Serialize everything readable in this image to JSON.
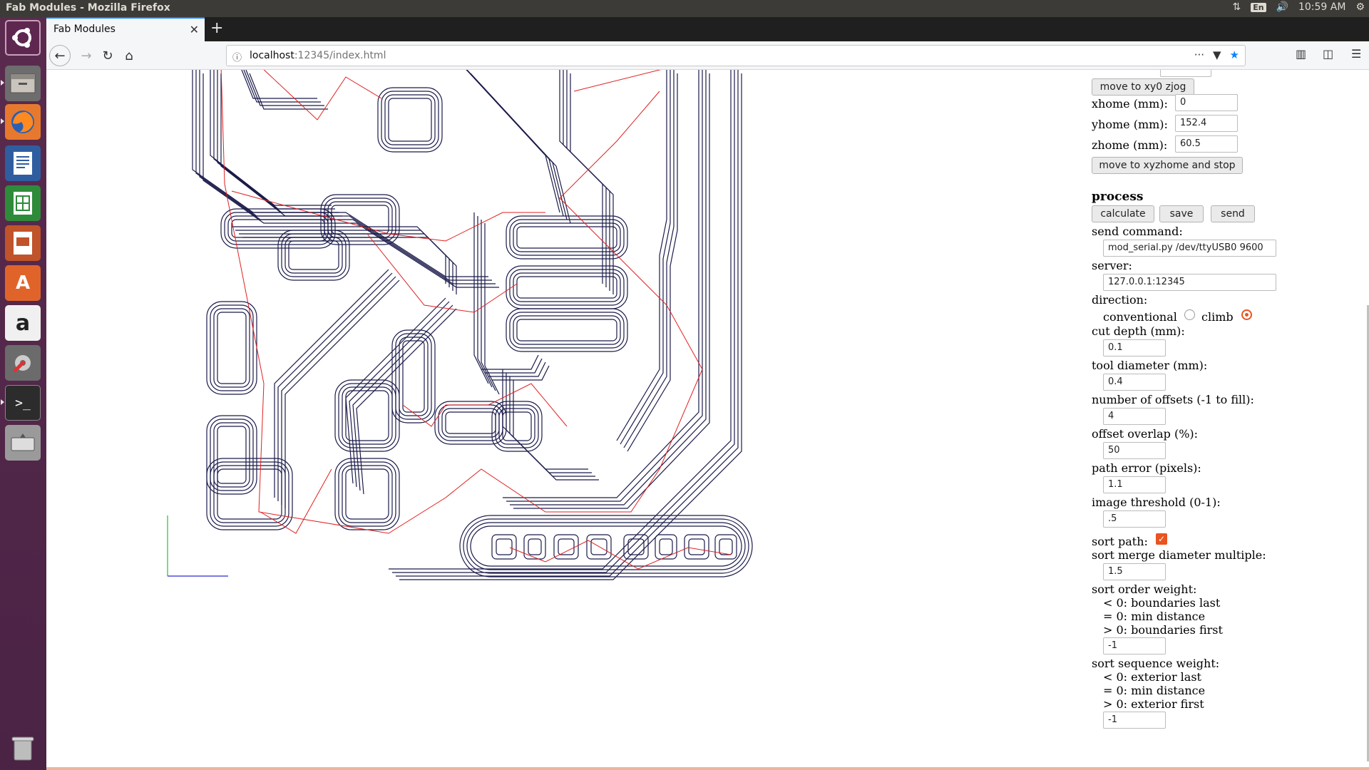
{
  "window": {
    "title": "Fab Modules - Mozilla Firefox"
  },
  "top_panel": {
    "keyboard": "En",
    "time": "10:59 AM"
  },
  "launcher": {
    "items": [
      "ubuntu-dash-icon",
      "files-icon",
      "firefox-icon",
      "writer-icon",
      "calc-icon",
      "impress-icon",
      "software-center-icon",
      "amazon-icon",
      "system-settings-icon",
      "terminal-icon",
      "disk-icon",
      "trash-icon"
    ]
  },
  "browser": {
    "tab_title": "Fab Modules",
    "url_host": "localhost",
    "url_path": ":12345/index.html"
  },
  "controls": {
    "move_xy0_zjog_label": "move to xy0 zjog",
    "xhome_label": "xhome (mm):",
    "xhome_value": "0",
    "yhome_label": "yhome (mm):",
    "yhome_value": "152.4",
    "zhome_label": "zhome (mm):",
    "zhome_value": "60.5",
    "move_home_label": "move to xyzhome and stop",
    "process_heading": "process",
    "calculate_label": "calculate",
    "save_label": "save",
    "send_label": "send",
    "send_command_label": "send command:",
    "send_command_value": "mod_serial.py /dev/ttyUSB0 9600",
    "server_label": "server:",
    "server_value": "127.0.0.1:12345",
    "direction_label": "direction:",
    "conventional_label": "conventional",
    "climb_label": "climb",
    "direction_selected": "climb",
    "cut_depth_label": "cut depth (mm):",
    "cut_depth_value": "0.1",
    "tool_diameter_label": "tool diameter (mm):",
    "tool_diameter_value": "0.4",
    "offsets_label": "number of offsets (-1 to fill):",
    "offsets_value": "4",
    "overlap_label": "offset overlap (%):",
    "overlap_value": "50",
    "path_error_label": "path error (pixels):",
    "path_error_value": "1.1",
    "threshold_label": "image threshold (0-1):",
    "threshold_value": ".5",
    "sort_path_label": "sort path:",
    "sort_path_checked": true,
    "merge_label": "sort merge diameter multiple:",
    "merge_value": "1.5",
    "order_weight_label": "sort order weight:",
    "order_weight_lines": [
      "< 0: boundaries last",
      "= 0: min distance",
      "> 0: boundaries first"
    ],
    "order_weight_value": "-1",
    "sequence_weight_label": "sort sequence weight:",
    "sequence_weight_lines": [
      "< 0: exterior last",
      "= 0: min distance",
      "> 0: exterior first"
    ],
    "sequence_weight_value": "-1"
  },
  "colors": {
    "toolpath": "#1a1a4a",
    "move": "#e02020",
    "accent": "#e95420"
  }
}
